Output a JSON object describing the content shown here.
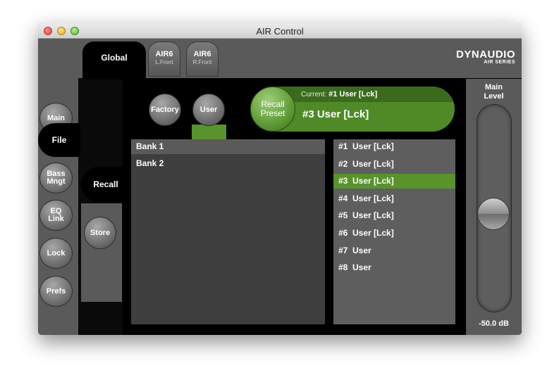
{
  "window": {
    "title": "AIR Control"
  },
  "tabs": {
    "global": "Global",
    "air6_left": {
      "name": "AIR6",
      "sub": "L.Front"
    },
    "air6_right": {
      "name": "AIR6",
      "sub": "R.Front"
    }
  },
  "logo": {
    "brand": "DYNAUDIO",
    "series": "AIR SERIES"
  },
  "nav": {
    "main": "Main",
    "file": "File",
    "bass_l1": "Bass",
    "bass_l2": "Mngt",
    "eq_l1": "EQ",
    "eq_l2": "Link",
    "lock": "Lock",
    "prefs": "Prefs"
  },
  "subnav": {
    "recall": "Recall",
    "store": "Store"
  },
  "source": {
    "factory": "Factory",
    "user": "User"
  },
  "preset_bar": {
    "recall_l1": "Recall",
    "recall_l2": "Preset",
    "current_label": "Current:",
    "current_value": "#1  User [Lck]",
    "selected": "#3  User [Lck]"
  },
  "banks": [
    "Bank 1",
    "Bank 2"
  ],
  "selected_bank": 0,
  "presets": [
    "#1  User [Lck]",
    "#2  User [Lck]",
    "#3  User [Lck]",
    "#4  User [Lck]",
    "#5  User [Lck]",
    "#6  User [Lck]",
    "#7  User",
    "#8  User"
  ],
  "selected_preset": 2,
  "main_level": {
    "label_l1": "Main",
    "label_l2": "Level",
    "value": "-50.0 dB",
    "fader_position": 0.53
  },
  "colors": {
    "accent_green": "#58932b",
    "background": "#5a5a5a",
    "panel_black": "#000000"
  }
}
